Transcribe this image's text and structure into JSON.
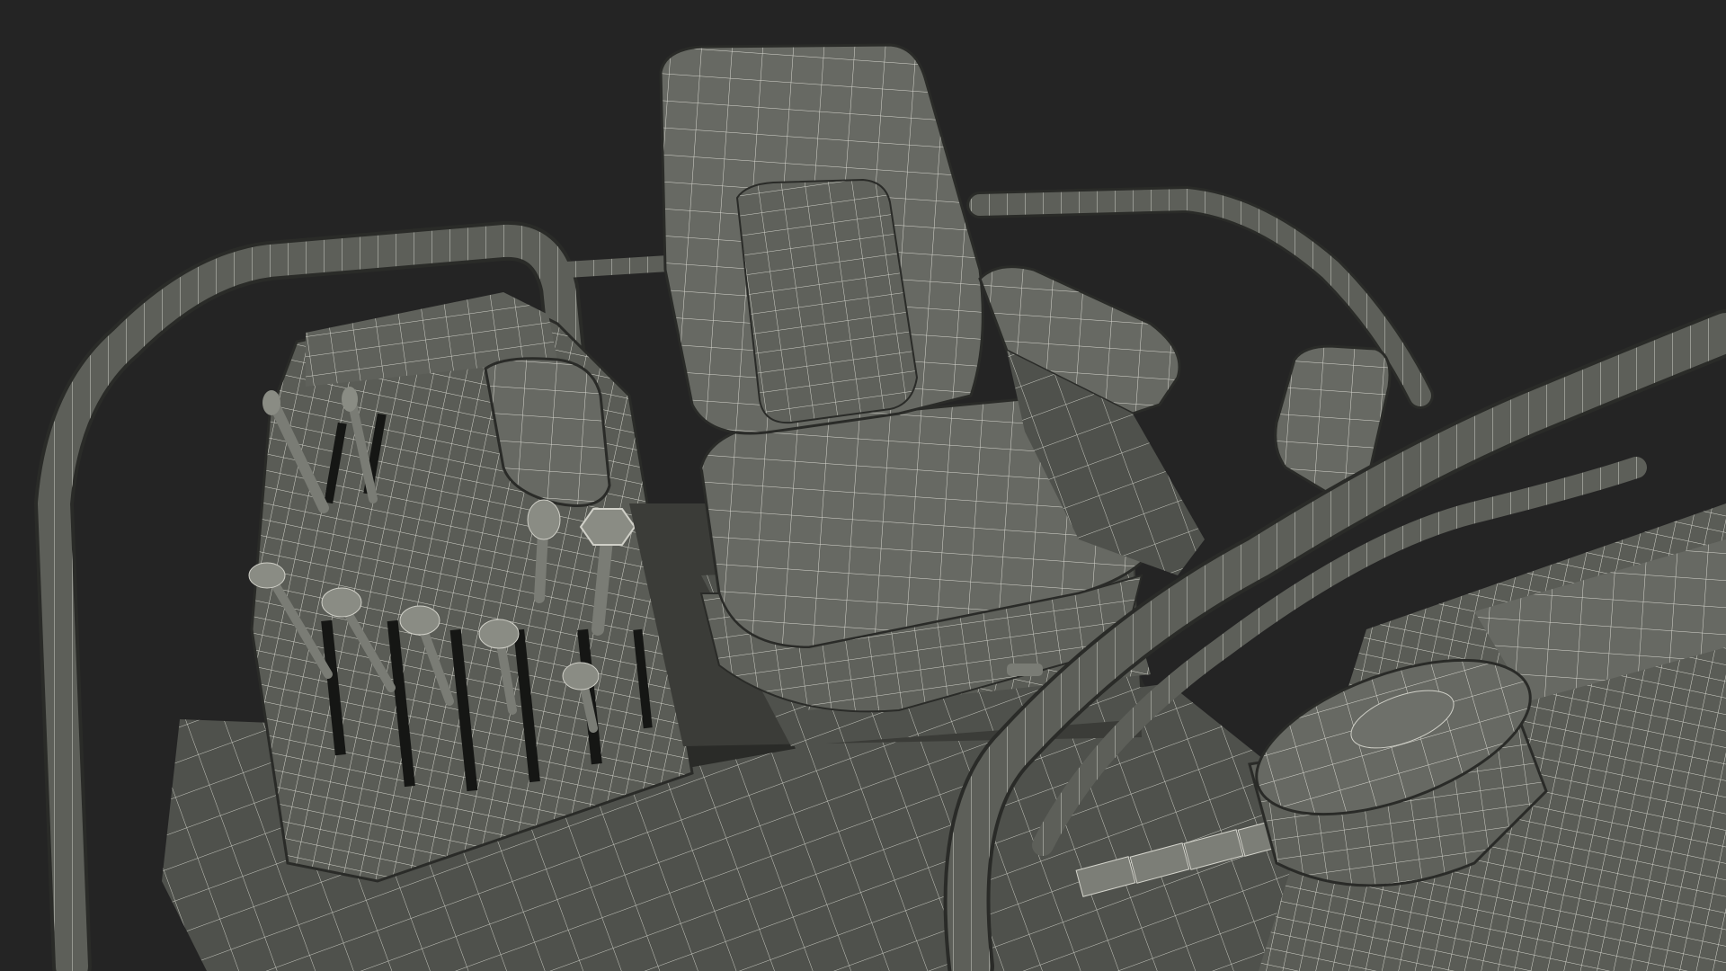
{
  "scene": {
    "subject": "wireframe-seat-cab",
    "colors": {
      "background": "#242424",
      "surface": "#5c5e58",
      "surface_light": "#6b6d66",
      "surface_dark": "#4a4c47",
      "wire": "#d6d6cf",
      "shadow": "#1c1d1b"
    },
    "icons": [
      "operator-seat",
      "armrest-console",
      "control-levers",
      "roll-bar",
      "hydraulic-tank"
    ]
  }
}
